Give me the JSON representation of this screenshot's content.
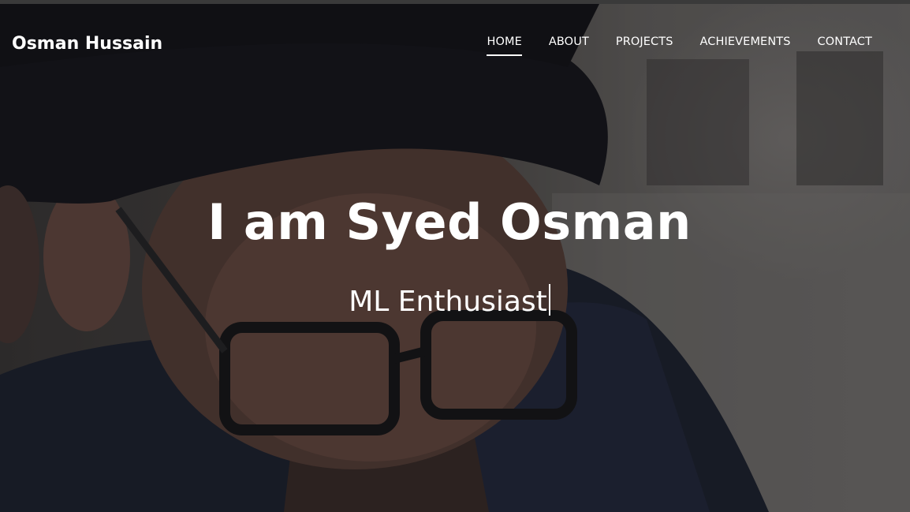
{
  "brand": {
    "name": "Osman Hussain"
  },
  "nav": {
    "items": [
      {
        "label": "HOME",
        "active": true
      },
      {
        "label": "ABOUT",
        "active": false
      },
      {
        "label": "PROJECTS",
        "active": false
      },
      {
        "label": "ACHIEVEMENTS",
        "active": false
      },
      {
        "label": "CONTACT",
        "active": false
      }
    ]
  },
  "hero": {
    "title": "I am Syed Osman",
    "subtitle": "ML Enthusiast"
  },
  "colors": {
    "text": "#ffffff",
    "overlay": "#14141a"
  }
}
